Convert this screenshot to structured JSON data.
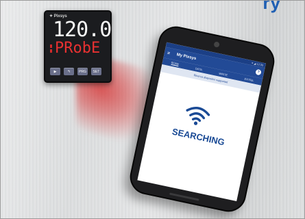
{
  "page": {
    "top_text": "ry"
  },
  "controller": {
    "brand": "Pixsys",
    "display_value": "120.0",
    "display_label": "PRobE",
    "buttons": [
      "▶",
      "↰",
      "PRG",
      "SET"
    ]
  },
  "phone": {
    "status_bar": "▾ ◢ 12:35",
    "app_title": "My Pixsys",
    "menu_icon": "≡",
    "help_icon": "?",
    "tabs": [
      "SCAN",
      "DATA",
      "WRITE",
      "EXTRA"
    ],
    "active_tab": "SCAN",
    "notice": "Ricerca dispositivi supportati",
    "search_text": "SEARCHING"
  },
  "colors": {
    "app_blue": "#224a96",
    "text_blue": "#1a4a95",
    "display_red": "#e83131"
  }
}
